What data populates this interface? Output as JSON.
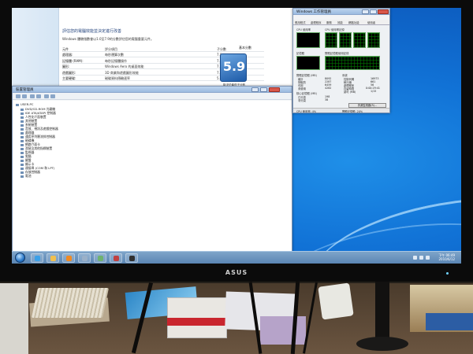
{
  "monitor": {
    "brand": "ASUS"
  },
  "perf_window": {
    "title": "",
    "sidebar_links": [
      "",
      "",
      "",
      "",
      "",
      ""
    ],
    "heading": "評估您的電腦效能並決定進行改善",
    "subtext": "Windows 體驗指數會以1.0至7.9的分數評估您的電腦重要元件。",
    "columns": {
      "component": "元件",
      "rating": "評分項目",
      "subscore": "子分數",
      "base": "基本分數"
    },
    "rows": [
      {
        "component": "處理器:",
        "rating": "每秒運算次數",
        "subscore": "7.9"
      },
      {
        "component": "記憶體 (RAM):",
        "rating": "每秒記憶體操作",
        "subscore": "7.9"
      },
      {
        "component": "圖形:",
        "rating": "Windows Aero 的桌面效能",
        "subscore": "7.9"
      },
      {
        "component": "遊戲圖形:",
        "rating": "3D 商業和遊戲圖形效能",
        "subscore": "7.9"
      },
      {
        "component": "主要硬碟:",
        "rating": "磁碟資料傳輸速率",
        "subscore": "5.9"
      }
    ],
    "base_score": "5.9",
    "base_caption": "取決於最低子分數"
  },
  "device_manager": {
    "title": "裝置管理員",
    "root": "USER-PC",
    "items": [
      "DVD/CD-ROM 光碟機",
      "IDE ATA/ATAPI 控制器",
      "人性化介面裝置",
      "其他裝置",
      "系統裝置",
      "音效、視訊及遊戲控制器",
      "處理器",
      "通用序列匯流排控制器",
      "磁碟機",
      "網路介面卡",
      "滑鼠及其他指標裝置",
      "監視器",
      "電腦",
      "鍵盤",
      "顯示卡",
      "連接埠 (COM 和 LPT)",
      "存放控制器",
      "電池"
    ]
  },
  "task_manager": {
    "title": "Windows 工作管理員",
    "tabs": [
      "應用程式",
      "處理程序",
      "服務",
      "效能",
      "網路功能",
      "使用者"
    ],
    "labels": {
      "cpu_usage": "CPU 使用率",
      "cpu_history": "CPU 使用率記錄",
      "memory": "記憶體",
      "memory_history": "實體記憶體使用記錄"
    },
    "physical_memory": {
      "label": "實體記憶體 (MB)",
      "stats": [
        [
          "總計",
          "8092"
        ],
        [
          "快取的",
          "2287"
        ],
        [
          "可用",
          "6459"
        ],
        [
          "未使用",
          "4282"
        ]
      ]
    },
    "kernel_memory": {
      "label": "核心記憶體 (MB)",
      "stats": [
        [
          "已分頁",
          "198"
        ],
        [
          "非分頁",
          "38"
        ]
      ]
    },
    "system": {
      "label": "系統",
      "stats": [
        [
          "控制代碼",
          "16973"
        ],
        [
          "執行緒",
          "661"
        ],
        [
          "處理程序",
          "56"
        ],
        [
          "存留時間",
          "0:00:29:41"
        ],
        [
          "認可 (MB)",
          "1/15"
        ]
      ]
    },
    "resource_button": "資源監視器(R)...",
    "status_cpu": "CPU 使用率: 4%",
    "status_mem": "實體記憶體: 20%"
  },
  "taskbar": {
    "clock_time": "下午 06:49",
    "clock_date": "2010/6/12",
    "apps": [
      {
        "name": "ie-icon",
        "color": "#3aa0e8"
      },
      {
        "name": "explorer-folder-icon",
        "color": "#f0c050"
      },
      {
        "name": "media-player-icon",
        "color": "#f08a24"
      },
      {
        "name": "device-manager-icon",
        "color": "#9ab0c8"
      },
      {
        "name": "performance-icon",
        "color": "#6fb26f"
      },
      {
        "name": "task-manager-icon",
        "color": "#c04040"
      },
      {
        "name": "cmd-icon",
        "color": "#303030"
      }
    ]
  }
}
